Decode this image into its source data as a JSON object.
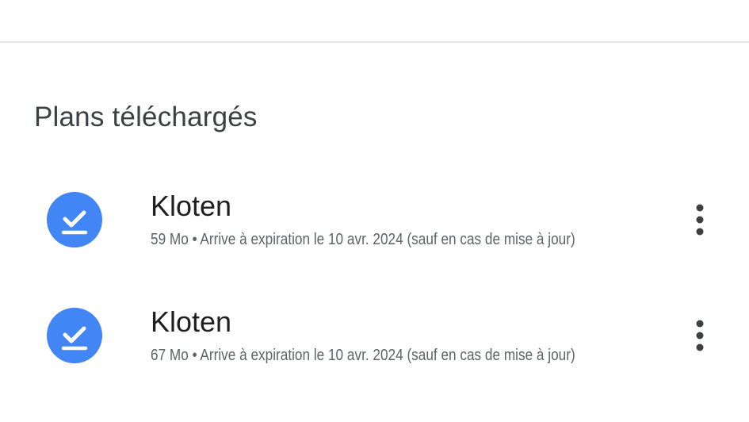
{
  "section": {
    "title": "Plans téléchargés"
  },
  "offline_maps": [
    {
      "name": "Kloten",
      "size": "59 Mo",
      "separator": "•",
      "expiry": "Arrive à expiration le 10 avr. 2024 (sauf en cas de mise à jour)",
      "details": "59 Mo • Arrive à expiration le 10 avr. 2024 (sauf en cas de mise à jour)",
      "status_icon": "download-done-icon",
      "menu_icon": "more-vert-icon"
    },
    {
      "name": "Kloten",
      "size": "67 Mo",
      "separator": "•",
      "expiry": "Arrive à expiration le 10 avr. 2024 (sauf en cas de mise à jour)",
      "details": "67 Mo • Arrive à expiration le 10 avr. 2024 (sauf en cas de mise à jour)",
      "status_icon": "download-done-icon",
      "menu_icon": "more-vert-icon"
    }
  ],
  "colors": {
    "accent": "#4285f4",
    "title_text": "#3c4043",
    "primary_text": "#1f1f1f",
    "secondary_text": "#5f6368",
    "divider": "#e3e3e3"
  }
}
